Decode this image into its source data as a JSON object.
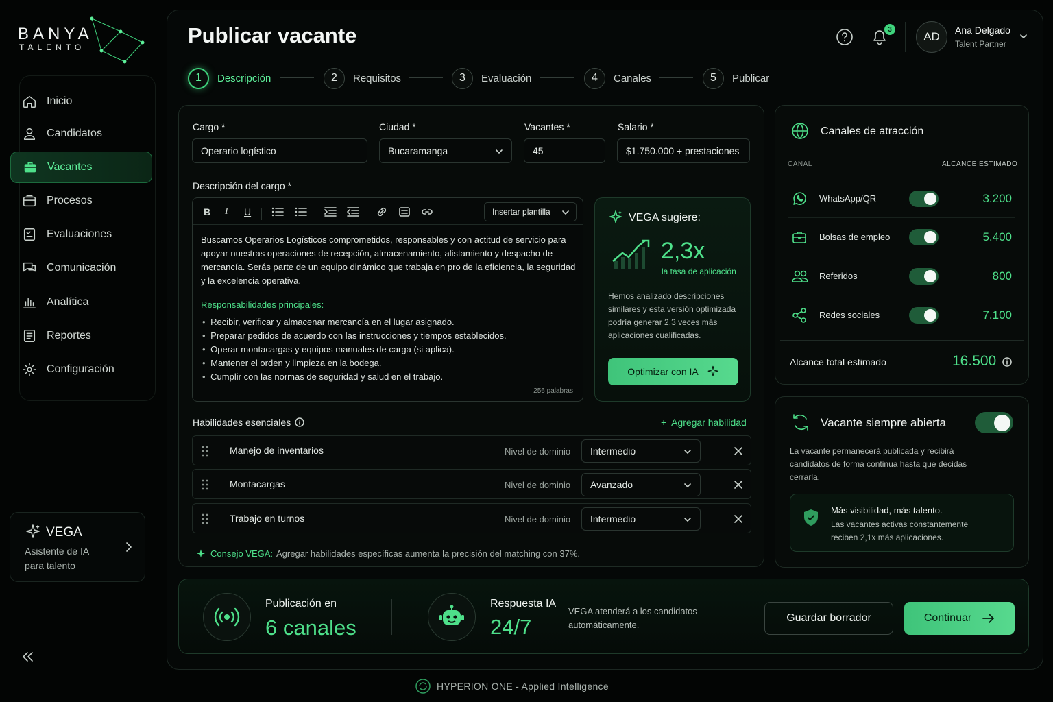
{
  "brand": {
    "name": "BANYA",
    "tagline": "TALENTO"
  },
  "sidebar": {
    "items": [
      {
        "label": "Inicio",
        "icon": "home-icon"
      },
      {
        "label": "Candidatos",
        "icon": "user-icon"
      },
      {
        "label": "Vacantes",
        "icon": "briefcase-icon",
        "active": true
      },
      {
        "label": "Procesos",
        "icon": "folder-icon"
      },
      {
        "label": "Evaluaciones",
        "icon": "checklist-icon"
      },
      {
        "label": "Comunicación",
        "icon": "chat-icon"
      },
      {
        "label": "Analítica",
        "icon": "bar-chart-icon"
      },
      {
        "label": "Reportes",
        "icon": "report-icon"
      },
      {
        "label": "Configuración",
        "icon": "gear-icon"
      }
    ],
    "vega": {
      "title": "VEGA",
      "subtitle_line1": "Asistente de IA",
      "subtitle_line2": "para talento"
    }
  },
  "header": {
    "title": "Publicar vacante",
    "notifications": "3",
    "user": {
      "initials": "AD",
      "name": "Ana Delgado",
      "role": "Talent Partner"
    }
  },
  "steps": [
    {
      "num": "1",
      "label": "Descripción",
      "active": true
    },
    {
      "num": "2",
      "label": "Requisitos"
    },
    {
      "num": "3",
      "label": "Evaluación"
    },
    {
      "num": "4",
      "label": "Canales"
    },
    {
      "num": "5",
      "label": "Publicar"
    }
  ],
  "form": {
    "cargo": {
      "label": "Cargo *",
      "value": "Operario logístico"
    },
    "ciudad": {
      "label": "Ciudad *",
      "value": "Bucaramanga"
    },
    "vacantes": {
      "label": "Vacantes *",
      "value": "45"
    },
    "salario": {
      "label": "Salario *",
      "value": "$1.750.000 + prestaciones"
    },
    "descripcion_label": "Descripción del cargo *",
    "insert_template": "Insertar plantilla",
    "description": "Buscamos Operarios Logísticos comprometidos, responsables y con actitud de servicio para apoyar nuestras operaciones de recepción, almacenamiento, alistamiento y despacho de mercancía. Serás parte de un equipo dinámico que trabaja en pro de la eficiencia, la seguridad y la excelencia operativa.",
    "resp_title": "Responsabilidades principales:",
    "responsibilities": [
      "Recibir, verificar y almacenar mercancía en el lugar asignado.",
      "Preparar pedidos de acuerdo con las instrucciones y tiempos establecidos.",
      "Operar montacargas y equipos manuales de carga (si aplica).",
      "Mantener el orden y limpieza en la bodega.",
      "Cumplir con las normas de seguridad y salud en el trabajo."
    ],
    "word_count": "256 palabras"
  },
  "vega_suggest": {
    "title": "VEGA sugiere:",
    "metric": "2,3x",
    "metric_label": "la tasa de aplicación",
    "text": "Hemos analizado descripciones similares y esta versión optimizada podría generar 2,3 veces más aplicaciones cualificadas.",
    "button": "Optimizar con IA"
  },
  "skills": {
    "label": "Habilidades esenciales",
    "add": "Agregar habilidad",
    "level_label": "Nivel de dominio",
    "rows": [
      {
        "name": "Manejo de inventarios",
        "level": "Intermedio"
      },
      {
        "name": "Montacargas",
        "level": "Avanzado"
      },
      {
        "name": "Trabajo en turnos",
        "level": "Intermedio"
      }
    ],
    "tip_label": "Consejo VEGA:",
    "tip_text": "Agregar habilidades específicas aumenta la precisión del matching con 37%."
  },
  "channels": {
    "title": "Canales de atracción",
    "col_channel": "CANAL",
    "col_reach": "ALCANCE ESTIMADO",
    "rows": [
      {
        "name": "WhatsApp/QR",
        "value": "3.200",
        "on": true
      },
      {
        "name": "Bolsas de empleo",
        "value": "5.400",
        "on": true
      },
      {
        "name": "Referidos",
        "value": "800",
        "on": true
      },
      {
        "name": "Redes sociales",
        "value": "7.100",
        "on": true
      }
    ],
    "total_label": "Alcance total estimado",
    "total_value": "16.500"
  },
  "always_open": {
    "title": "Vacante siempre abierta",
    "on": true,
    "text": "La vacante permanecerá publicada y recibirá candidatos de forma continua hasta que decidas cerrarla.",
    "tip_title": "Más visibilidad, más talento.",
    "tip_text": "Las vacantes activas constantemente reciben 2,1x más aplicaciones."
  },
  "footer_bar": {
    "pub_label": "Publicación en",
    "pub_value": "6 canales",
    "ia_label": "Respuesta IA",
    "ia_value": "24/7",
    "ia_text": "VEGA atenderá a los candidatos automáticamente.",
    "save": "Guardar borrador",
    "continue": "Continuar"
  },
  "credit": "HYPERION ONE - Applied Intelligence",
  "colors": {
    "accent": "#4ee08a",
    "background": "#030504",
    "panel": "#070b09"
  }
}
